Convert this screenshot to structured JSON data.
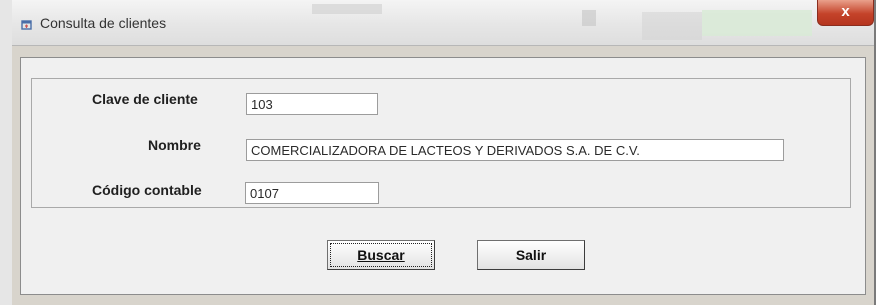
{
  "window": {
    "title": "Consulta de clientes",
    "close_glyph": "x"
  },
  "form": {
    "clave": {
      "label": "Clave de cliente",
      "value": "103"
    },
    "nombre": {
      "label": "Nombre",
      "value": "COMERCIALIZADORA DE LACTEOS Y DERIVADOS S.A. DE C.V."
    },
    "codigo": {
      "label": "Código contable",
      "value": "0107"
    }
  },
  "buttons": {
    "buscar": "Buscar",
    "salir": "Salir"
  },
  "icons": {
    "app": "window-app-icon",
    "close": "close-icon"
  },
  "colors": {
    "close_button": "#c4432a",
    "dialog_bg": "#f0f0f0"
  }
}
